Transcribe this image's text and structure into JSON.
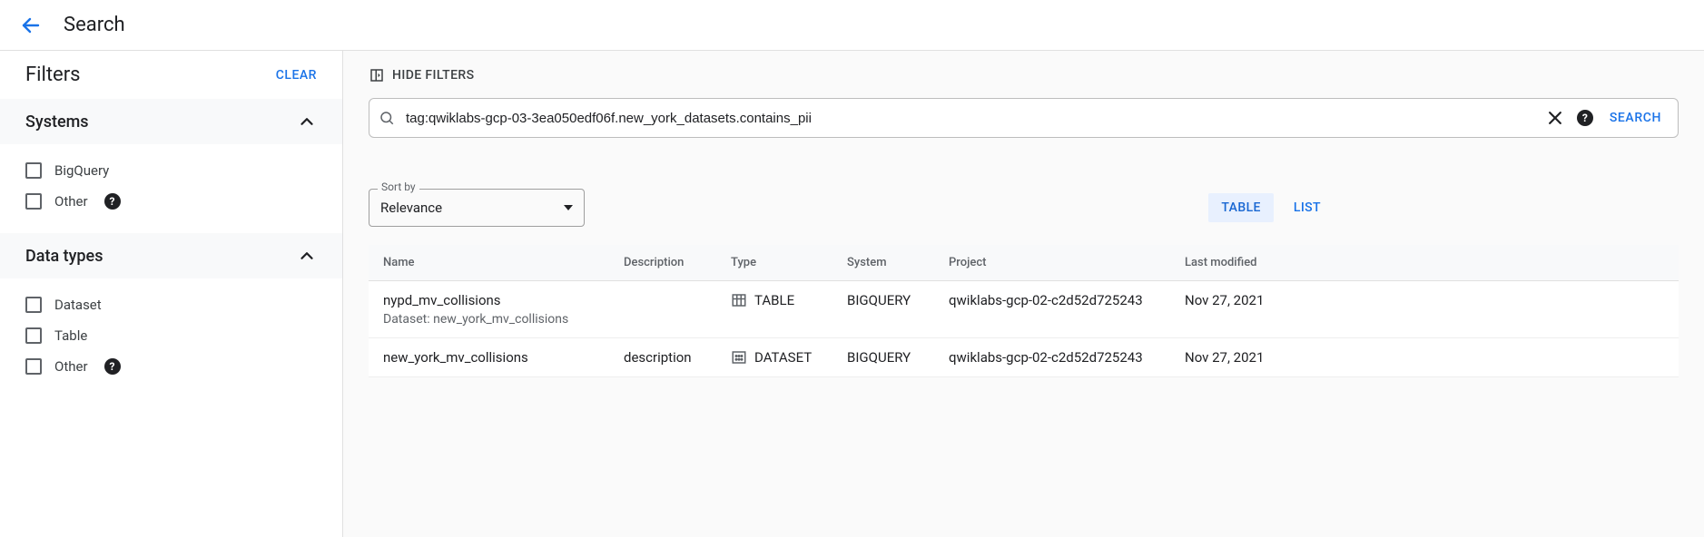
{
  "header": {
    "title": "Search"
  },
  "filters": {
    "panel_title": "Filters",
    "clear_label": "CLEAR",
    "groups": [
      {
        "title": "Systems",
        "options": [
          {
            "label": "BigQuery",
            "help": false
          },
          {
            "label": "Other",
            "help": true
          }
        ]
      },
      {
        "title": "Data types",
        "options": [
          {
            "label": "Dataset",
            "help": false
          },
          {
            "label": "Table",
            "help": false
          },
          {
            "label": "Other",
            "help": true
          }
        ]
      }
    ]
  },
  "main": {
    "hide_filters_label": "HIDE FILTERS",
    "search_value": "tag:qwiklabs-gcp-03-3ea050edf06f.new_york_datasets.contains_pii",
    "search_button": "SEARCH",
    "sort": {
      "legend": "Sort by",
      "selected": "Relevance"
    },
    "view": {
      "table": "TABLE",
      "list": "LIST",
      "active": "table"
    },
    "columns": {
      "name": "Name",
      "description": "Description",
      "type": "Type",
      "system": "System",
      "project": "Project",
      "last_modified": "Last modified"
    },
    "rows": [
      {
        "name": "nypd_mv_collisions",
        "subtext_prefix": "Dataset: ",
        "subtext_value": "new_york_mv_collisions",
        "description": "",
        "type": "TABLE",
        "type_icon": "table",
        "system": "BIGQUERY",
        "project": "qwiklabs-gcp-02-c2d52d725243",
        "last_modified": "Nov 27, 2021"
      },
      {
        "name": "new_york_mv_collisions",
        "subtext_prefix": "",
        "subtext_value": "",
        "description": "description",
        "type": "DATASET",
        "type_icon": "dataset",
        "system": "BIGQUERY",
        "project": "qwiklabs-gcp-02-c2d52d725243",
        "last_modified": "Nov 27, 2021"
      }
    ]
  }
}
